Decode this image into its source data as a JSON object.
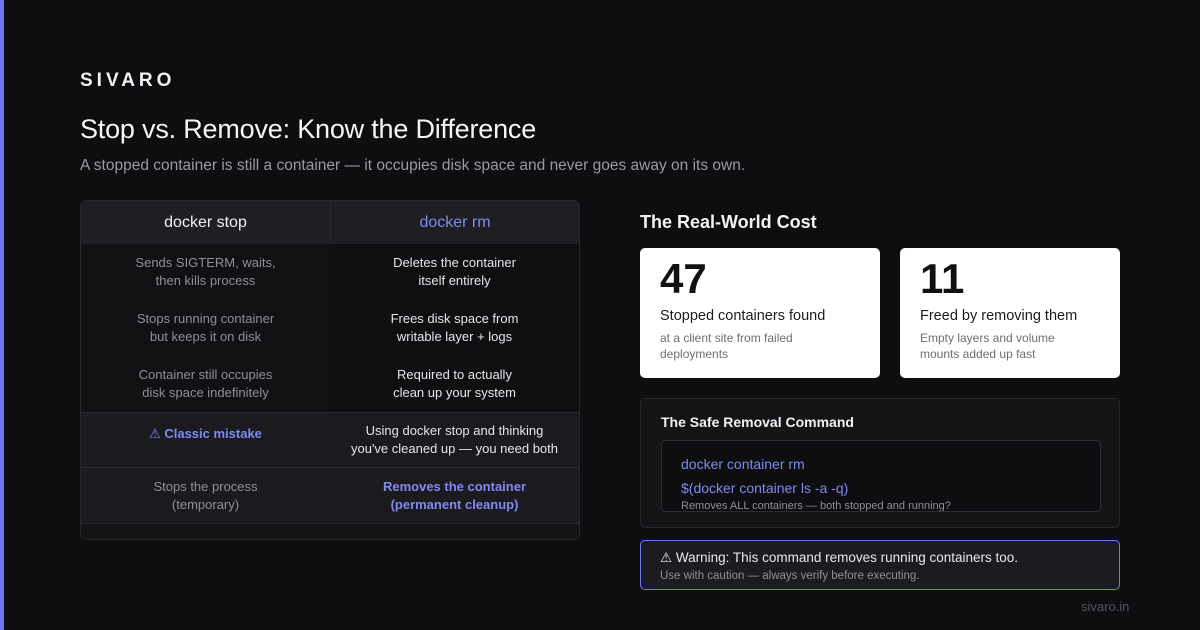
{
  "brand": "SIVARO",
  "title": "Stop vs. Remove: Know the Difference",
  "subtitle": "A stopped container is still a container — it occupies disk space and never goes away on its own.",
  "table": {
    "headers": [
      "docker stop",
      "docker rm"
    ],
    "rows": [
      [
        "Sends SIGTERM, waits,\nthen kills process",
        "Deletes the container\nitself entirely"
      ],
      [
        "Stops running container\nbut keeps it on disk",
        "Frees disk space from\nwritable layer + logs"
      ],
      [
        "Container still occupies\ndisk space indefinitely",
        "Required to actually\nclean up your system"
      ],
      [
        "⚠ Classic mistake",
        "Using docker stop and thinking\nyou've cleaned up — you need both"
      ],
      [
        "Stops the process\n(temporary)",
        "Removes the container\n(permanent cleanup)"
      ]
    ]
  },
  "cost": {
    "title": "The Real-World Cost",
    "stats": [
      {
        "number": "47",
        "label": "Stopped containers found",
        "desc": "at a client site from failed\ndeployments"
      },
      {
        "number": "11",
        "label": "Freed by removing them",
        "desc": "Empty layers and volume\nmounts added up fast"
      }
    ]
  },
  "command": {
    "title": "The Safe Removal Command",
    "line1": "docker container rm",
    "line2": "$(docker container ls -a -q)",
    "note": "Removes ALL containers — both stopped and running?"
  },
  "warning": {
    "main": "⚠ Warning: This command removes running containers too.",
    "sub": "Use with caution — always verify before executing."
  },
  "footer_url": "sivaro.in",
  "colors": {
    "accent": "#6f78ee",
    "background": "#0e0e10"
  }
}
